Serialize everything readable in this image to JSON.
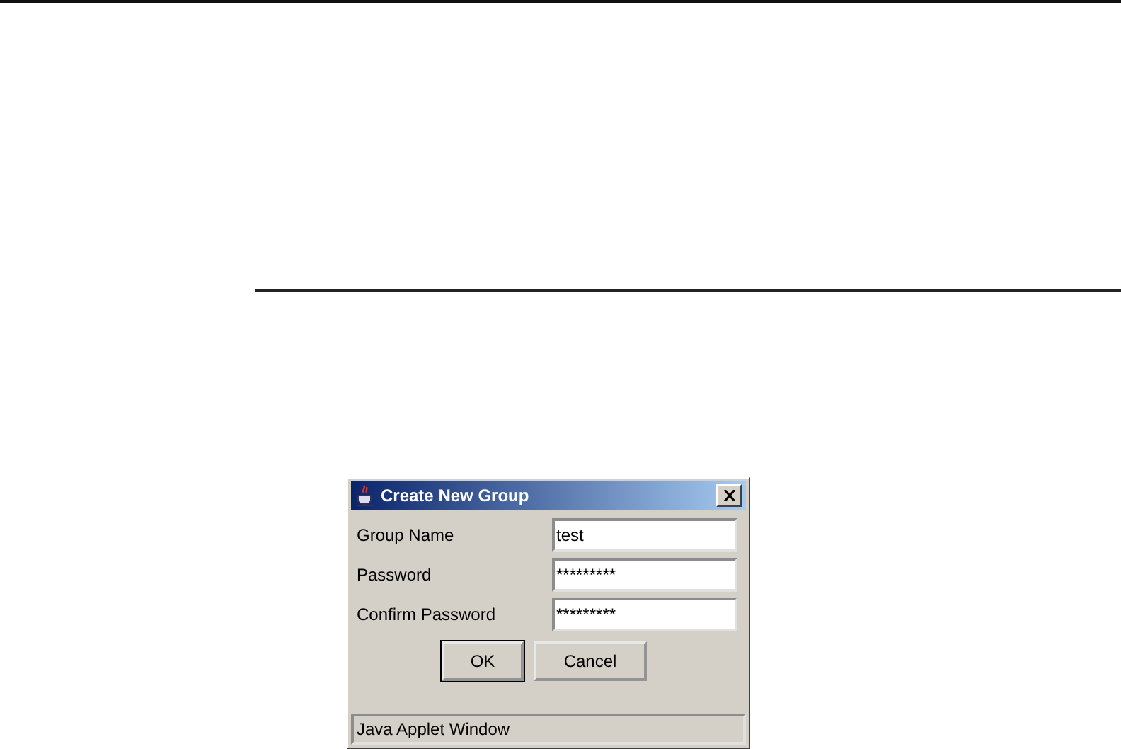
{
  "dialog": {
    "title": "Create New Group",
    "fields": [
      {
        "label": "Group Name",
        "value": "test"
      },
      {
        "label": "Password",
        "value": "*********"
      },
      {
        "label": "Confirm Password",
        "value": "*********"
      }
    ],
    "buttons": [
      "OK",
      "Cancel"
    ],
    "status_bar": "Java Applet Window"
  }
}
